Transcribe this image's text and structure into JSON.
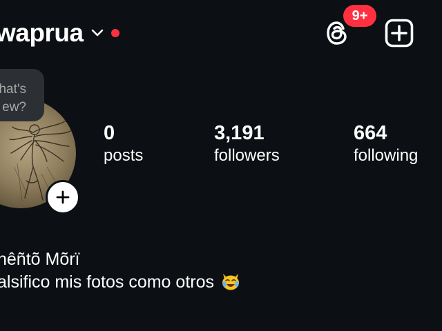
{
  "header": {
    "username": "waprua",
    "threads_badge": "9+",
    "icons": {
      "dropdown": "chevron-down-icon",
      "threads": "threads-icon",
      "create": "plus-square-icon"
    }
  },
  "note": {
    "line1": "hat's",
    "line2": "ew?"
  },
  "stats": {
    "posts": {
      "value": "0",
      "label": "posts"
    },
    "followers": {
      "value": "3,191",
      "label": "followers"
    },
    "following": {
      "value": "664",
      "label": "following"
    }
  },
  "bio": {
    "name": "hêñtõ Mõrï",
    "text": "alsifico mis fotos como otros",
    "emoji": "crying-laughing-cat-emoji"
  },
  "colors": {
    "background": "#0c1014",
    "badge": "#ff3040",
    "note_bubble": "#2c2f33",
    "text": "#ffffff"
  }
}
